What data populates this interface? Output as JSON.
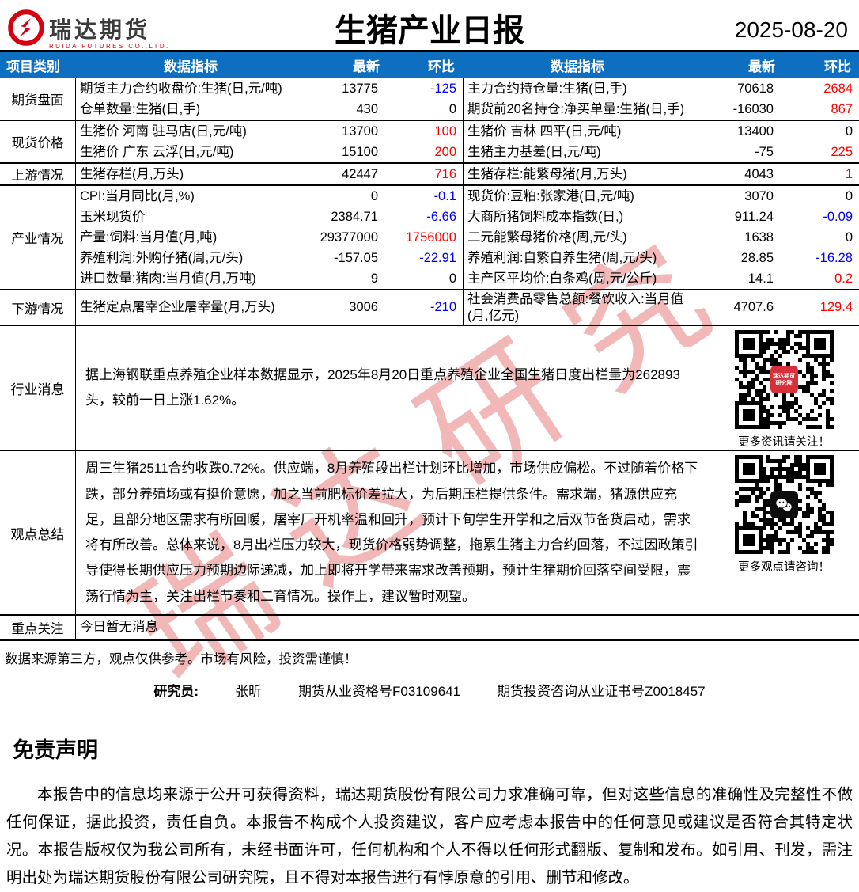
{
  "watermark": {
    "text": "瑞达研究"
  },
  "header": {
    "brand": "瑞达期货",
    "brand_sub": "RUIDA FUTURES CO.,LTD.",
    "title": "生猪产业日报",
    "date": "2025-08-20"
  },
  "colors": {
    "header_blue": "#0e6fc1",
    "up_red": "#ff0000",
    "down_blue": "#0000ff",
    "logo_red": "#d6000f"
  },
  "table": {
    "columns": [
      "项目类别",
      "数据指标",
      "最新",
      "环比",
      "数据指标",
      "最新",
      "环比"
    ],
    "sections": [
      {
        "category": "期货盘面",
        "rows": [
          {
            "l_name": "期货主力合约收盘价:生猪(日,元/吨)",
            "l_val": "13775",
            "l_chg": "-125",
            "l_chg_color": "blue",
            "r_name": "主力合约持仓量:生猪(日,手)",
            "r_val": "70618",
            "r_chg": "2684",
            "r_chg_color": "red"
          },
          {
            "l_name": "仓单数量:生猪(日,手)",
            "l_val": "430",
            "l_chg": "0",
            "l_chg_color": "black",
            "r_name": "期货前20名持仓:净买单量:生猪(日,手)",
            "r_val": "-16030",
            "r_chg": "867",
            "r_chg_color": "red"
          }
        ]
      },
      {
        "category": "现货价格",
        "rows": [
          {
            "l_name": "生猪价 河南 驻马店(日,元/吨)",
            "l_val": "13700",
            "l_chg": "100",
            "l_chg_color": "red",
            "r_name": "生猪价 吉林 四平(日,元/吨)",
            "r_val": "13400",
            "r_chg": "0",
            "r_chg_color": "black"
          },
          {
            "l_name": "生猪价 广东 云浮(日,元/吨)",
            "l_val": "15100",
            "l_chg": "200",
            "l_chg_color": "red",
            "r_name": "生猪主力基差(日,元/吨)",
            "r_val": "-75",
            "r_chg": "225",
            "r_chg_color": "red"
          }
        ]
      },
      {
        "category": "上游情况",
        "rows": [
          {
            "l_name": "生猪存栏(月,万头)",
            "l_val": "42447",
            "l_chg": "716",
            "l_chg_color": "red",
            "r_name": "生猪存栏:能繁母猪(月,万头)",
            "r_val": "4043",
            "r_chg": "1",
            "r_chg_color": "red"
          }
        ]
      },
      {
        "category": "产业情况",
        "rows": [
          {
            "l_name": "CPI:当月同比(月,%)",
            "l_val": "0",
            "l_chg": "-0.1",
            "l_chg_color": "blue",
            "r_name": "现货价:豆粕:张家港(日,元/吨)",
            "r_val": "3070",
            "r_chg": "0",
            "r_chg_color": "black"
          },
          {
            "l_name": "玉米现货价",
            "l_val": "2384.71",
            "l_chg": "-6.66",
            "l_chg_color": "blue",
            "r_name": "大商所猪饲料成本指数(日,)",
            "r_val": "911.24",
            "r_chg": "-0.09",
            "r_chg_color": "blue"
          },
          {
            "l_name": "产量:饲料:当月值(月,吨)",
            "l_val": "29377000",
            "l_chg": "1756000",
            "l_chg_color": "red",
            "r_name": "二元能繁母猪价格(周,元/头)",
            "r_val": "1638",
            "r_chg": "0",
            "r_chg_color": "black"
          },
          {
            "l_name": "养殖利润:外购仔猪(周,元/头)",
            "l_val": "-157.05",
            "l_chg": "-22.91",
            "l_chg_color": "blue",
            "r_name": "养殖利润:自繁自养生猪(周,元/头)",
            "r_val": "28.85",
            "r_chg": "-16.28",
            "r_chg_color": "blue"
          },
          {
            "l_name": "进口数量:猪肉:当月值(月,万吨)",
            "l_val": "9",
            "l_chg": "0",
            "l_chg_color": "black",
            "r_name": "主产区平均价:白条鸡(周,元/公斤)",
            "r_val": "14.1",
            "r_chg": "0.2",
            "r_chg_color": "red"
          }
        ]
      },
      {
        "category": "下游情况",
        "rows": [
          {
            "l_name": "生猪定点屠宰企业屠宰量(月,万头)",
            "l_val": "3006",
            "l_chg": "-210",
            "l_chg_color": "blue",
            "r_name": "社会消费品零售总额:餐饮收入:当月值(月,亿元)",
            "r_val": "4707.6",
            "r_chg": "129.4",
            "r_chg_color": "red"
          }
        ]
      }
    ]
  },
  "news": {
    "category": "行业消息",
    "text": "据上海钢联重点养殖企业样本数据显示，2025年8月20日重点养殖企业全国生猪日度出栏量为262893头，较前一日上涨1.62%。",
    "qr_caption": "更多资讯请关注！",
    "qr_badge_line1": "瑞达期货",
    "qr_badge_line2": "研究院"
  },
  "views": {
    "category": "观点总结",
    "text": "周三生猪2511合约收跌0.72%。供应端，8月养殖段出栏计划环比增加，市场供应偏松。不过随着价格下跌，部分养殖场或有挺价意愿，加之当前肥标价差拉大，为后期压栏提供条件。需求端，猪源供应充足，且部分地区需求有所回暖，屠宰厂开机率温和回升，预计下旬学生开学和之后双节备货启动，需求将有所改善。总体来说，8月出栏压力较大，现货价格弱势调整，拖累生猪主力合约回落，不过因政策引导使得长期供应压力预期边际递减，加上即将开学带来需求改善预期，预计生猪期价回落空间受限，震荡行情为主，关注出栏节奏和二育情况。操作上，建议暂时观望。",
    "qr_caption": "更多观点请咨询！"
  },
  "focus": {
    "category": "重点关注",
    "text": "今日暂无消息"
  },
  "footer": {
    "note": "数据来源第三方，观点仅供参考。市场有风险，投资需谨慎！",
    "researcher_label": "研究员:",
    "researcher_name": "张昕",
    "qualification1": "期货从业资格号F03109641",
    "qualification2": "期货投资咨询从业证书号Z0018457"
  },
  "disclaimer": {
    "heading": "免责声明",
    "body": "本报告中的信息均来源于公开可获得资料，瑞达期货股份有限公司力求准确可靠，但对这些信息的准确性及完整性不做任何保证，据此投资，责任自负。本报告不构成个人投资建议，客户应考虑本报告中的任何意见或建议是否符合其特定状况。本报告版权仅为我公司所有，未经书面许可，任何机构和个人不得以任何形式翻版、复制和发布。如引用、刊发，需注明出处为瑞达期货股份有限公司研究院，且不得对本报告进行有悖原意的引用、删节和修改。"
  }
}
